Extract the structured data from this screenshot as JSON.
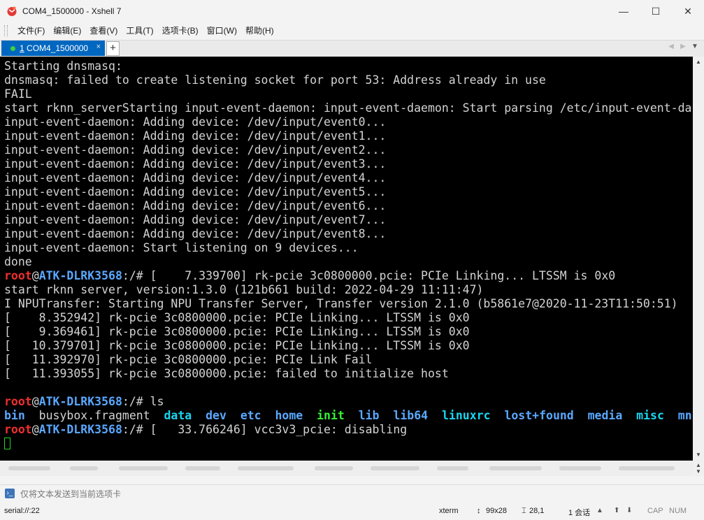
{
  "window": {
    "title": "COM4_1500000 - Xshell 7",
    "controls": {
      "minimize": "—",
      "maximize": "☐",
      "close": "✕"
    }
  },
  "menu": [
    "文件(F)",
    "编辑(E)",
    "查看(V)",
    "工具(T)",
    "选项卡(B)",
    "窗口(W)",
    "帮助(H)"
  ],
  "tab": {
    "index": "1",
    "label": "COM4_1500000",
    "close": "×",
    "add": "+"
  },
  "terminal": {
    "lines": [
      [
        {
          "t": "Starting dnsmasq:",
          "c": "c-white"
        }
      ],
      [
        {
          "t": "dnsmasq: failed to create listening socket for port 53: Address already in use",
          "c": "c-white"
        }
      ],
      [
        {
          "t": "FAIL",
          "c": "c-white"
        }
      ],
      [
        {
          "t": "start rknn_serverStarting input-event-daemon: input-event-daemon: Start parsing /etc/input-event-da",
          "c": "c-white"
        }
      ],
      [
        {
          "t": "input-event-daemon: Adding device: /dev/input/event0...",
          "c": "c-white"
        }
      ],
      [
        {
          "t": "input-event-daemon: Adding device: /dev/input/event1...",
          "c": "c-white"
        }
      ],
      [
        {
          "t": "input-event-daemon: Adding device: /dev/input/event2...",
          "c": "c-white"
        }
      ],
      [
        {
          "t": "input-event-daemon: Adding device: /dev/input/event3...",
          "c": "c-white"
        }
      ],
      [
        {
          "t": "input-event-daemon: Adding device: /dev/input/event4...",
          "c": "c-white"
        }
      ],
      [
        {
          "t": "input-event-daemon: Adding device: /dev/input/event5...",
          "c": "c-white"
        }
      ],
      [
        {
          "t": "input-event-daemon: Adding device: /dev/input/event6...",
          "c": "c-white"
        }
      ],
      [
        {
          "t": "input-event-daemon: Adding device: /dev/input/event7...",
          "c": "c-white"
        }
      ],
      [
        {
          "t": "input-event-daemon: Adding device: /dev/input/event8...",
          "c": "c-white"
        }
      ],
      [
        {
          "t": "input-event-daemon: Start listening on 9 devices...",
          "c": "c-white"
        }
      ],
      [
        {
          "t": "done",
          "c": "c-white"
        }
      ],
      [
        {
          "t": "root",
          "c": "c-red"
        },
        {
          "t": "@",
          "c": "c-white"
        },
        {
          "t": "ATK-DLRK3568",
          "c": "c-blue"
        },
        {
          "t": ":/# [    7.339700] rk-pcie 3c0800000.pcie: PCIe Linking... LTSSM is 0x0",
          "c": "c-white"
        }
      ],
      [
        {
          "t": "start rknn server, version:1.3.0 (121b661 build: 2022-04-29 11:11:47)",
          "c": "c-white"
        }
      ],
      [
        {
          "t": "I NPUTransfer: Starting NPU Transfer Server, Transfer version 2.1.0 (b5861e7@2020-11-23T11:50:51)",
          "c": "c-white"
        }
      ],
      [
        {
          "t": "[    8.352942] rk-pcie 3c0800000.pcie: PCIe Linking... LTSSM is 0x0",
          "c": "c-white"
        }
      ],
      [
        {
          "t": "[    9.369461] rk-pcie 3c0800000.pcie: PCIe Linking... LTSSM is 0x0",
          "c": "c-white"
        }
      ],
      [
        {
          "t": "[   10.379701] rk-pcie 3c0800000.pcie: PCIe Linking... LTSSM is 0x0",
          "c": "c-white"
        }
      ],
      [
        {
          "t": "[   11.392970] rk-pcie 3c0800000.pcie: PCIe Link Fail",
          "c": "c-white"
        }
      ],
      [
        {
          "t": "[   11.393055] rk-pcie 3c0800000.pcie: failed to initialize host",
          "c": "c-white"
        }
      ],
      [
        {
          "t": "",
          "c": "c-white"
        }
      ],
      [
        {
          "t": "root",
          "c": "c-red"
        },
        {
          "t": "@",
          "c": "c-white"
        },
        {
          "t": "ATK-DLRK3568",
          "c": "c-blue"
        },
        {
          "t": ":/# ls",
          "c": "c-white"
        }
      ],
      [
        {
          "t": "bin",
          "c": "c-blue"
        },
        {
          "t": "  busybox.fragment  ",
          "c": "c-white"
        },
        {
          "t": "data",
          "c": "c-cyan"
        },
        {
          "t": "  ",
          "c": "c-white"
        },
        {
          "t": "dev",
          "c": "c-blue"
        },
        {
          "t": "  ",
          "c": "c-white"
        },
        {
          "t": "etc",
          "c": "c-blue"
        },
        {
          "t": "  ",
          "c": "c-white"
        },
        {
          "t": "home",
          "c": "c-blue"
        },
        {
          "t": "  ",
          "c": "c-white"
        },
        {
          "t": "init",
          "c": "c-green"
        },
        {
          "t": "  ",
          "c": "c-white"
        },
        {
          "t": "lib",
          "c": "c-blue"
        },
        {
          "t": "  ",
          "c": "c-white"
        },
        {
          "t": "lib64",
          "c": "c-blue"
        },
        {
          "t": "  ",
          "c": "c-white"
        },
        {
          "t": "linuxrc",
          "c": "c-cyan"
        },
        {
          "t": "  ",
          "c": "c-white"
        },
        {
          "t": "lost+found",
          "c": "c-blue"
        },
        {
          "t": "  ",
          "c": "c-white"
        },
        {
          "t": "media",
          "c": "c-blue"
        },
        {
          "t": "  ",
          "c": "c-white"
        },
        {
          "t": "misc",
          "c": "c-cyan"
        },
        {
          "t": "  ",
          "c": "c-white"
        },
        {
          "t": "mn",
          "c": "c-blue"
        }
      ],
      [
        {
          "t": "root",
          "c": "c-red"
        },
        {
          "t": "@",
          "c": "c-white"
        },
        {
          "t": "ATK-DLRK3568",
          "c": "c-blue"
        },
        {
          "t": ":/# [   33.766246] vcc3v3_pcie: disabling",
          "c": "c-white"
        }
      ],
      [
        {
          "cursor": true
        }
      ]
    ]
  },
  "send_bar": {
    "placeholder": "仅将文本发送到当前选项卡"
  },
  "status": {
    "connection": "serial://:22",
    "term_type": "xterm",
    "size": "99x28",
    "position": "28,1",
    "sessions": "1 会话",
    "caps": "CAP",
    "num": "NUM"
  },
  "colors": {
    "tab_active": "#0067c0",
    "prompt_user": "#ef2f2f",
    "prompt_host": "#5aa8ff",
    "cursor": "#22d622"
  }
}
